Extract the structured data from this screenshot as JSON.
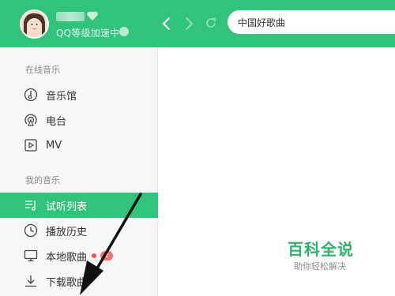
{
  "header": {
    "vip_text": "QQ等级加速中",
    "search_value": "中国好歌曲"
  },
  "sidebar": {
    "online_section": "在线音乐",
    "online_items": [
      {
        "label": "音乐馆",
        "icon": "music-hall-icon"
      },
      {
        "label": "电台",
        "icon": "radio-icon"
      },
      {
        "label": "MV",
        "icon": "mv-icon"
      }
    ],
    "my_section": "我的音乐",
    "my_items": [
      {
        "label": "试听列表",
        "icon": "playlist-icon",
        "active": true
      },
      {
        "label": "播放历史",
        "icon": "history-icon"
      },
      {
        "label": "本地歌曲",
        "icon": "computer-icon",
        "badge": "2"
      },
      {
        "label": "下载歌曲",
        "icon": "download-icon"
      }
    ]
  },
  "watermark": {
    "title": "百科全说",
    "subtitle": "助你轻松解决"
  },
  "colors": {
    "brand": "#31c27c",
    "badge_red": "#ff6e6e"
  }
}
